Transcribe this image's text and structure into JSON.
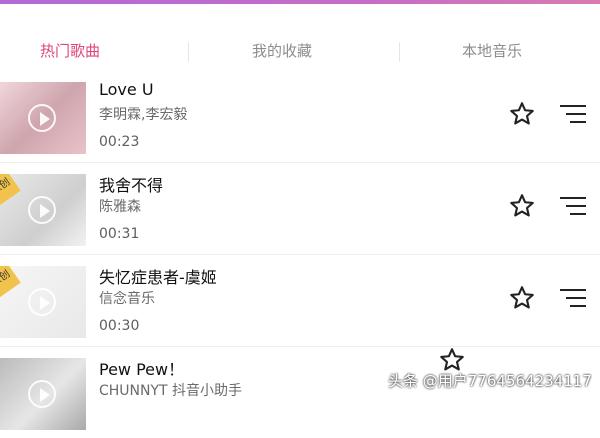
{
  "tabs": [
    {
      "label": "热门歌曲",
      "active": true
    },
    {
      "label": "我的收藏",
      "active": false
    },
    {
      "label": "本地音乐",
      "active": false
    }
  ],
  "songs": [
    {
      "title": "Love U",
      "artist": "李明霖,李宏毅",
      "duration": "00:23"
    },
    {
      "title": "我舍不得",
      "artist": "陈雅森",
      "duration": "00:31",
      "badge": "原创"
    },
    {
      "title": "失忆症患者-虞姬",
      "artist": "信念音乐",
      "duration": "00:30",
      "badge": "原创"
    },
    {
      "title": "Pew Pew！",
      "artist": "CHUNNYT 抖音小助手",
      "duration": ""
    }
  ],
  "watermark": "头条 @用户7764564234117",
  "colors": {
    "accent": "#e0467a",
    "topbar": "#c56cc8"
  },
  "icons": {
    "favorite": "star-icon",
    "more": "menu-lines-icon",
    "play": "play-icon"
  }
}
